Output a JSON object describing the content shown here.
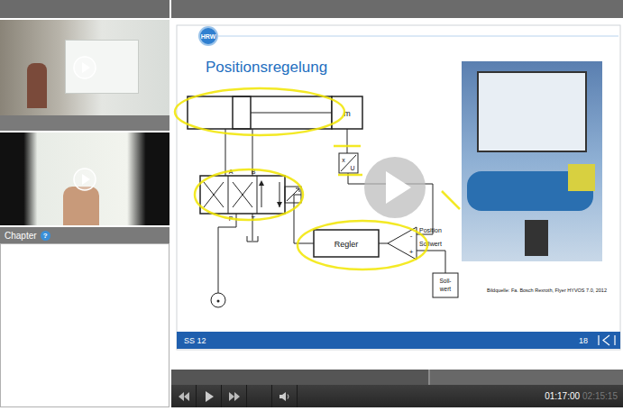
{
  "left_panel": {
    "chapter": {
      "title": "Chapter",
      "help": "?"
    }
  },
  "slide": {
    "logo": "HRW",
    "title": "Positionsregelung",
    "mass": "m",
    "port_labels": [
      "A",
      "B",
      "P",
      "T"
    ],
    "sensor": {
      "top": "x",
      "bottom": "U"
    },
    "controller": "Regler",
    "comparator": {
      "inputs": [
        "Position",
        "Sollwert"
      ],
      "signs": [
        "-",
        "+"
      ]
    },
    "setpoint": [
      "Soll-",
      "wert"
    ],
    "credit": "Bildquelle: Fa. Bosch Rexroth, Flyer HYVOS 7.0, 2012",
    "footer": {
      "left": "SS 12",
      "right": "18"
    }
  },
  "player": {
    "progress": {
      "level": 0.569
    },
    "time": {
      "current": "01:17:00",
      "total": "02:15:15"
    }
  }
}
